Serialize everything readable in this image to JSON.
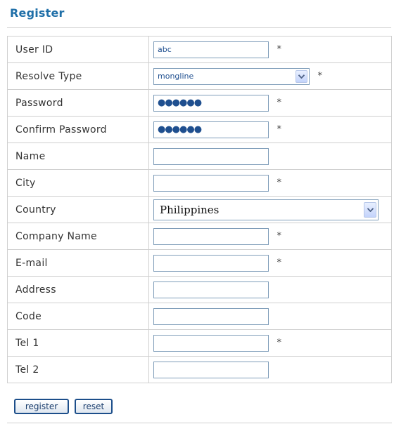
{
  "header": {
    "title": "Register"
  },
  "form": {
    "user_id": {
      "label": "User ID",
      "value": "abc",
      "required_mark": "*"
    },
    "resolve_type": {
      "label": "Resolve Type",
      "selected": "mongline",
      "required_mark": "*"
    },
    "password": {
      "label": "Password",
      "masked": "●●●●●●",
      "required_mark": "*"
    },
    "confirm_password": {
      "label": "Confirm Password",
      "masked": "●●●●●●",
      "required_mark": "*"
    },
    "name": {
      "label": "Name",
      "value": ""
    },
    "city": {
      "label": "City",
      "value": "",
      "required_mark": "*"
    },
    "country": {
      "label": "Country",
      "selected": "Philippines"
    },
    "company_name": {
      "label": "Company Name",
      "value": "",
      "required_mark": "*"
    },
    "email": {
      "label": "E-mail",
      "value": "",
      "required_mark": "*"
    },
    "address": {
      "label": "Address",
      "value": ""
    },
    "code": {
      "label": "Code",
      "value": ""
    },
    "tel1": {
      "label": "Tel 1",
      "value": "",
      "required_mark": "*"
    },
    "tel2": {
      "label": "Tel 2",
      "value": ""
    }
  },
  "actions": {
    "register_label": "register",
    "reset_label": "reset"
  },
  "colors": {
    "title": "#1f6fa8",
    "border": "#cfcfcf",
    "input_border": "#7f9db9",
    "button_border": "#1c4e8a"
  },
  "icons": {
    "dropdown": "chevron-down-icon"
  }
}
